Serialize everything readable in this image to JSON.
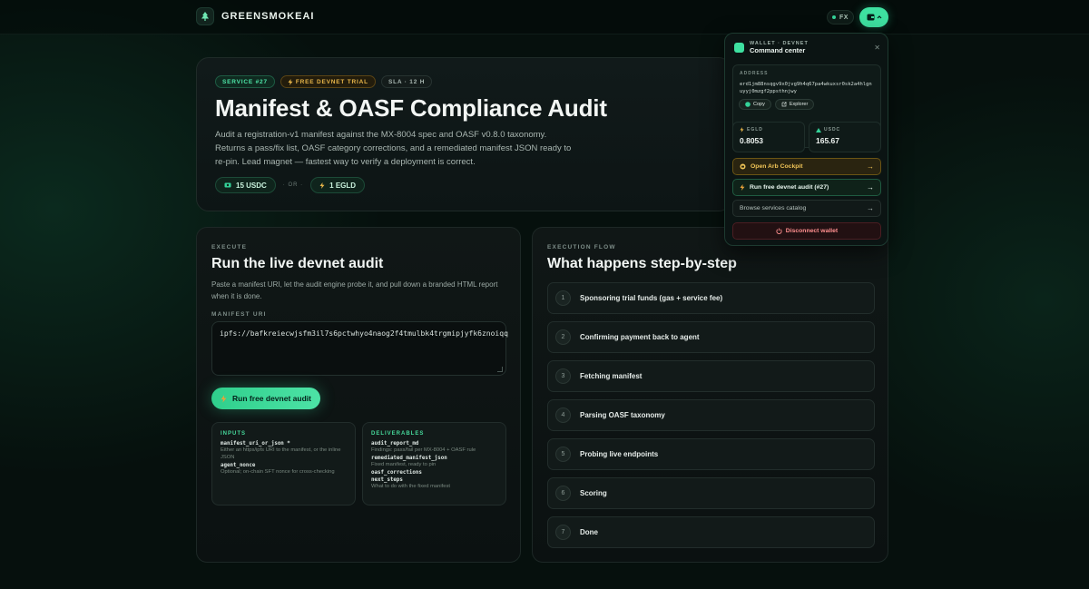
{
  "nav": {
    "brand": "GREENSMOKEAI",
    "fx_label": "FX"
  },
  "hero": {
    "badges": [
      "SERVICE #27",
      "FREE DEVNET TRIAL",
      "SLA · 12 H"
    ],
    "title": "Manifest & OASF Compliance Audit",
    "description": "Audit a registration-v1 manifest against the MX-8004 spec and OASF v0.8.0 taxonomy. Returns a pass/fix list, OASF category corrections, and a remediated manifest JSON ready to re-pin. Lead magnet — fastest way to verify a deployment is correct.",
    "price_usdc": "15 USDC",
    "or_label": "· OR ·",
    "price_egld": "1 EGLD"
  },
  "execute": {
    "eyebrow": "EXECUTE",
    "title": "Run the live devnet audit",
    "description": "Paste a manifest URI, let the audit engine probe it, and pull down a branded HTML report when it is done.",
    "uri_label": "MANIFEST URI",
    "uri_value": "ipfs://bafkreiecwjsfm3il7s6pctwhyo4naog2f4tmulbk4trgmipjyfk6znoiqq",
    "run_button": "Run free devnet audit",
    "inputs": {
      "title": "INPUTS",
      "items": [
        {
          "key": "manifest_uri_or_json *",
          "desc": "Either an https/ipfs URI to the manifest, or the inline JSON"
        },
        {
          "key": "agent_nonce",
          "desc": "Optional; on-chain SFT nonce for cross-checking"
        }
      ]
    },
    "deliverables": {
      "title": "DELIVERABLES",
      "items": [
        {
          "key": "audit_report_md",
          "desc": "Findings: pass/fail per MX-8004 + OASF rule"
        },
        {
          "key": "remediated_manifest_json",
          "desc": "Fixed manifest, ready to pin"
        },
        {
          "key": "oasf_corrections",
          "desc": ""
        },
        {
          "key": "next_steps",
          "desc": "What to do with the fixed manifest"
        }
      ]
    }
  },
  "flow": {
    "eyebrow": "EXECUTION FLOW",
    "title": "What happens step-by-step",
    "steps": [
      {
        "num": "1",
        "label": "Sponsoring trial funds (gas + service fee)"
      },
      {
        "num": "2",
        "label": "Confirming payment back to agent"
      },
      {
        "num": "3",
        "label": "Fetching manifest"
      },
      {
        "num": "4",
        "label": "Parsing OASF taxonomy"
      },
      {
        "num": "5",
        "label": "Probing live endpoints"
      },
      {
        "num": "6",
        "label": "Scoring"
      },
      {
        "num": "7",
        "label": "Done"
      }
    ]
  },
  "wallet": {
    "eyebrow": "WALLET · DEVNET",
    "title": "Command center",
    "address_label": "ADDRESS",
    "address": "erd1jm88nsqgv9x0jvg9h4q67pa4wkuxsr0sk2a4hlgnuyyj0mzgf2ppsthnjwy",
    "copy": "Copy",
    "explorer": "Explorer",
    "egld_label": "EGLD",
    "egld_value": "0.8053",
    "usdc_label": "USDC",
    "usdc_value": "165.67",
    "arb": "Open Arb Cockpit",
    "run": "Run free devnet audit (#27)",
    "browse": "Browse services catalog",
    "disconnect": "Disconnect wallet"
  },
  "colors": {
    "accent": "#3ee0a0",
    "gold": "#e8b64a",
    "danger": "#ff8f8f",
    "background": "#06100d"
  }
}
